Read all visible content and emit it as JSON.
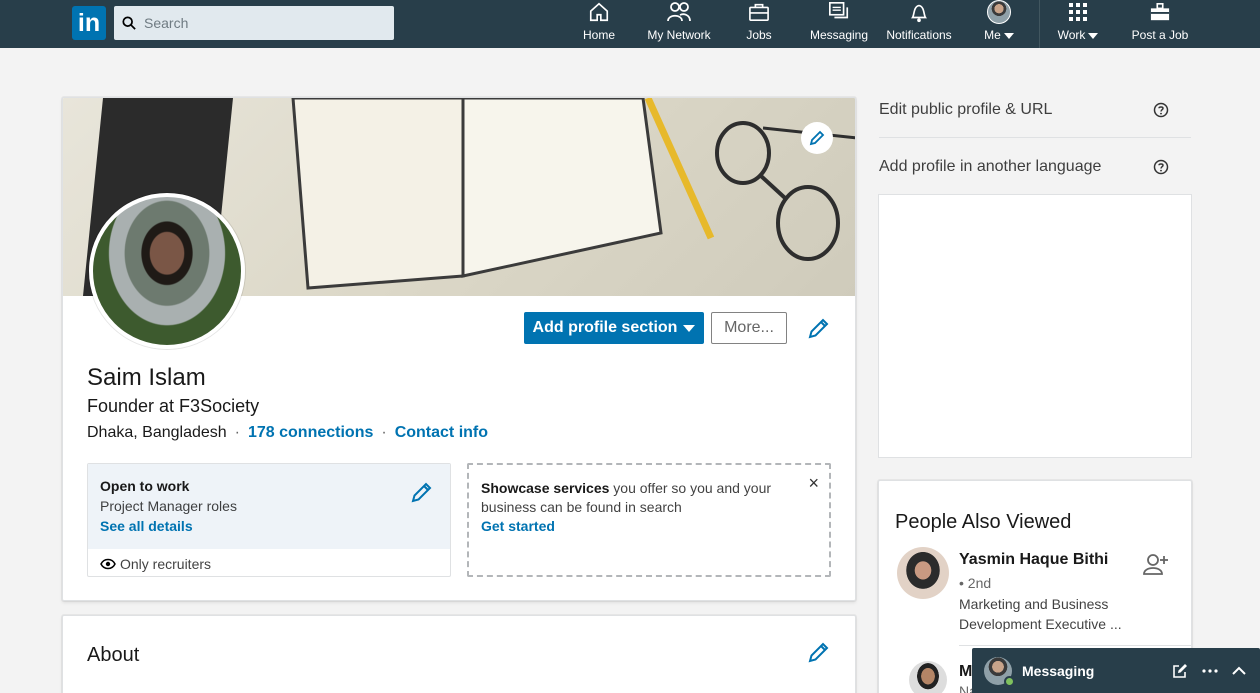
{
  "nav": {
    "logo_text": "in",
    "search_placeholder": "Search",
    "items": [
      {
        "label": "Home"
      },
      {
        "label": "My Network"
      },
      {
        "label": "Jobs"
      },
      {
        "label": "Messaging"
      },
      {
        "label": "Notifications"
      },
      {
        "label": "Me"
      },
      {
        "label": "Work"
      },
      {
        "label": "Post a Job"
      }
    ]
  },
  "profile": {
    "add_section_label": "Add profile section",
    "more_label": "More...",
    "name": "Saim Islam",
    "headline": "Founder at F3Society",
    "location": "Dhaka, Bangladesh",
    "separator": "·",
    "connections": "178 connections",
    "contact_info": "Contact info",
    "open_to_work": {
      "title": "Open to work",
      "roles": "Project Manager roles",
      "details_link": "See all details",
      "visibility": "Only recruiters"
    },
    "showcase": {
      "bold": "Showcase services",
      "text": " you offer so you and your business can be found in search",
      "link": "Get started",
      "close": "×"
    }
  },
  "about": {
    "title": "About"
  },
  "rail": {
    "edit_public_profile": "Edit public profile & URL",
    "add_language": "Add profile in another language",
    "people_also_viewed": {
      "title": "People Also Viewed",
      "people": [
        {
          "name": "Yasmin Haque Bithi",
          "degree": "• 2nd",
          "headline": "Marketing and Business Development Executive ..."
        },
        {
          "name": "M",
          "sub": "Na"
        }
      ]
    }
  },
  "messaging": {
    "title": "Messaging"
  },
  "colors": {
    "nav_bg": "#283e4a",
    "brand_blue": "#0073b1",
    "page_bg": "#f3f3f3"
  }
}
